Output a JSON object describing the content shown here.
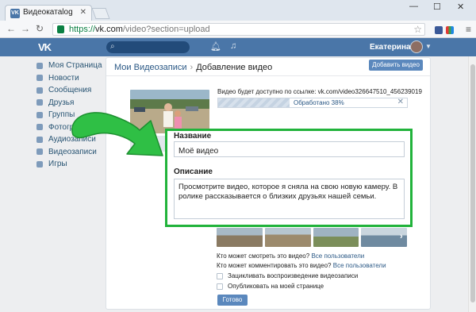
{
  "browser": {
    "tab_title": "Видеокатalog",
    "url_scheme": "https://",
    "url_host": "vk.com",
    "url_path": "/video?section=upload"
  },
  "header": {
    "search_placeholder": "",
    "user_name": "Екатерина"
  },
  "sidebar": {
    "items": [
      {
        "label": "Моя Страница",
        "icon": "home-icon"
      },
      {
        "label": "Новости",
        "icon": "news-icon"
      },
      {
        "label": "Сообщения",
        "icon": "messages-icon"
      },
      {
        "label": "Друзья",
        "icon": "friends-icon"
      },
      {
        "label": "Группы",
        "icon": "groups-icon"
      },
      {
        "label": "Фотографии",
        "icon": "photos-icon"
      },
      {
        "label": "Аудиозаписи",
        "icon": "audio-icon"
      },
      {
        "label": "Видеозаписи",
        "icon": "video-icon"
      },
      {
        "label": "Игры",
        "icon": "games-icon"
      }
    ]
  },
  "main": {
    "breadcrumb_root": "Мои Видеозаписи",
    "breadcrumb_current": "Добавление видео",
    "add_video_button": "Добавить видео",
    "link_prefix": "Видео будет доступно по ссылке: ",
    "link_url": "vk.com/video326647510_456239019",
    "progress_label": "Обработано 38%",
    "progress_fraction": 0.38,
    "title_label": "Название",
    "title_value": "Моё видео",
    "description_label": "Описание",
    "description_value": "Просмотрите видео, которое я сняла на свою новую камеру. В ролике рассказывается о близких друзьях нашей семьи.",
    "who_can_view_label": "Кто может смотреть это видео?",
    "who_can_view_value": "Все пользователи",
    "who_can_comment_label": "Кто может комментировать это видео?",
    "who_can_comment_value": "Все пользователи",
    "loop_label": "Зацикливать воспроизведение видеозаписи",
    "publish_label": "Опубликовать на моей странице",
    "done_button": "Готово"
  },
  "colors": {
    "vk_blue": "#4a76a8",
    "highlight_green": "#21b33b",
    "link_blue": "#2a5885"
  }
}
